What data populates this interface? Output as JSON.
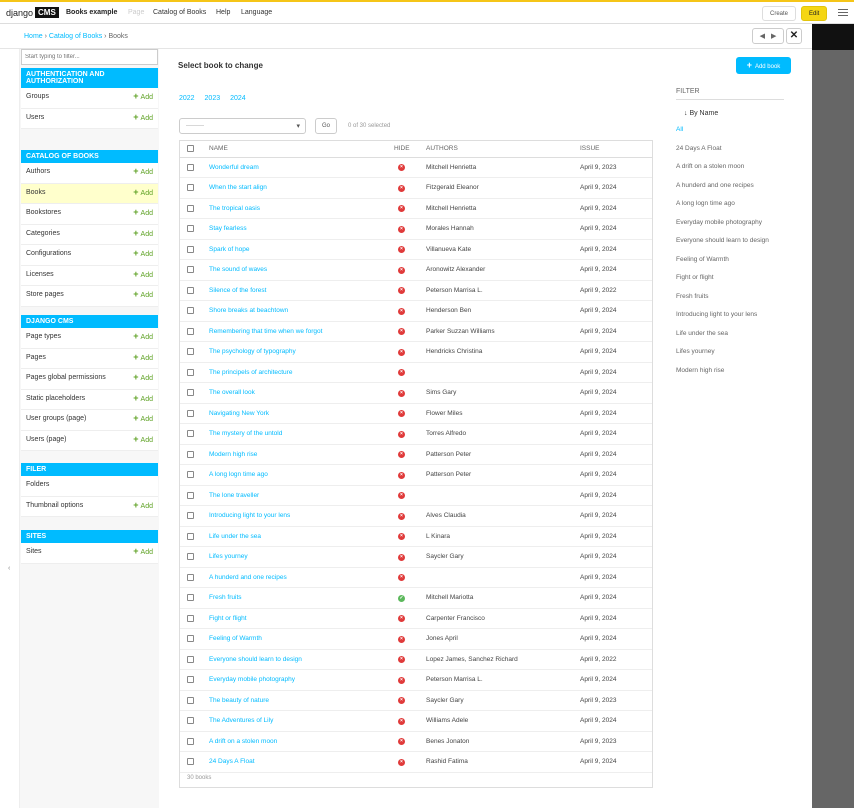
{
  "toolbar": {
    "logo_text": "django",
    "logo_box": "CMS",
    "site_name": "Books example",
    "page_label": "Page",
    "catalog_label": "Catalog of Books",
    "help_label": "Help",
    "language_label": "Language",
    "create_label": "Create",
    "edit_label": "Edit",
    "accent_color": "#00bbff",
    "edit_color": "#f5d613"
  },
  "breadcrumbs": {
    "home": "Home",
    "sep1": " › ",
    "catalog": "Catalog of Books",
    "sep2": " › ",
    "current": "Books"
  },
  "sidebar": {
    "filter_placeholder": "Start typing to filter...",
    "add_label": "Add",
    "modules": [
      {
        "title": "Authentication and Authorization",
        "items": [
          {
            "label": "Groups",
            "add": true
          },
          {
            "label": "Users",
            "add": true
          }
        ]
      },
      {
        "title": "Catalog of Books",
        "items": [
          {
            "label": "Authors",
            "add": true
          },
          {
            "label": "Books",
            "add": true,
            "active": true
          },
          {
            "label": "Bookstores",
            "add": true
          },
          {
            "label": "Categories",
            "add": true
          },
          {
            "label": "Configurations",
            "add": true
          },
          {
            "label": "Licenses",
            "add": true
          },
          {
            "label": "Store pages",
            "add": true
          }
        ]
      },
      {
        "title": "Django CMS",
        "items": [
          {
            "label": "Page types",
            "add": true
          },
          {
            "label": "Pages",
            "add": true
          },
          {
            "label": "Pages global permissions",
            "add": true
          },
          {
            "label": "Static placeholders",
            "add": true
          },
          {
            "label": "User groups (page)",
            "add": true
          },
          {
            "label": "Users (page)",
            "add": true
          }
        ]
      },
      {
        "title": "Filer",
        "items": [
          {
            "label": "Folders",
            "add": false
          },
          {
            "label": "Thumbnail options",
            "add": true
          }
        ]
      },
      {
        "title": "Sites",
        "items": [
          {
            "label": "Sites",
            "add": true
          }
        ]
      }
    ]
  },
  "content": {
    "title": "Select book to change",
    "add_button": "Add book",
    "years": [
      "2022",
      "2023",
      "2024"
    ],
    "action_placeholder": "---------",
    "go_label": "Go",
    "selected_text": "0 of 30 selected",
    "columns": [
      "Name",
      "Hide",
      "Authors",
      "Issue"
    ],
    "footer": "30 books",
    "rows": [
      {
        "name": "Wonderful dream",
        "hide": false,
        "authors": "Mitchell Henrietta",
        "issue": "April 9, 2023"
      },
      {
        "name": "When the start align",
        "hide": false,
        "authors": "Fitzgerald Eleanor",
        "issue": "April 9, 2024"
      },
      {
        "name": "The tropical oasis",
        "hide": false,
        "authors": "Mitchell Henrietta",
        "issue": "April 9, 2024"
      },
      {
        "name": "Stay fearless",
        "hide": false,
        "authors": "Morales Hannah",
        "issue": "April 9, 2024"
      },
      {
        "name": "Spark of hope",
        "hide": false,
        "authors": "Villanueva Kate",
        "issue": "April 9, 2024"
      },
      {
        "name": "The sound of waves",
        "hide": false,
        "authors": "Aronowitz Alexander",
        "issue": "April 9, 2024"
      },
      {
        "name": "Silence of the forest",
        "hide": false,
        "authors": "Peterson Marrisa L.",
        "issue": "April 9, 2022"
      },
      {
        "name": "Shore breaks at beachtown",
        "hide": false,
        "authors": "Henderson Ben",
        "issue": "April 9, 2024"
      },
      {
        "name": "Remembering that time when we forgot",
        "hide": false,
        "authors": "Parker Suzzan Williams",
        "issue": "April 9, 2024"
      },
      {
        "name": "The psychology of typography",
        "hide": false,
        "authors": "Hendricks Christina",
        "issue": "April 9, 2024"
      },
      {
        "name": "The principels of architecture",
        "hide": false,
        "authors": "",
        "issue": "April 9, 2024"
      },
      {
        "name": "The overall look",
        "hide": false,
        "authors": "Sims Gary",
        "issue": "April 9, 2024"
      },
      {
        "name": "Navigating New York",
        "hide": false,
        "authors": "Flower Miles",
        "issue": "April 9, 2024"
      },
      {
        "name": "The mystery of the untold",
        "hide": false,
        "authors": "Torres Alfredo",
        "issue": "April 9, 2024"
      },
      {
        "name": "Modern high rise",
        "hide": false,
        "authors": "Patterson Peter",
        "issue": "April 9, 2024"
      },
      {
        "name": "A long logn time ago",
        "hide": false,
        "authors": "Patterson Peter",
        "issue": "April 9, 2024"
      },
      {
        "name": "The lone traveller",
        "hide": false,
        "authors": "",
        "issue": "April 9, 2024"
      },
      {
        "name": "Introducing light to your lens",
        "hide": false,
        "authors": "Alves Claudia",
        "issue": "April 9, 2024"
      },
      {
        "name": "Life under the sea",
        "hide": false,
        "authors": "L Kinara",
        "issue": "April 9, 2024"
      },
      {
        "name": "Lifes yourney",
        "hide": false,
        "authors": "Saycler Gary",
        "issue": "April 9, 2024"
      },
      {
        "name": "A hunderd and one recipes",
        "hide": false,
        "authors": "",
        "issue": "April 9, 2024"
      },
      {
        "name": "Fresh fruits",
        "hide": true,
        "authors": "Mitchell Mariotta",
        "issue": "April 9, 2024"
      },
      {
        "name": "Fight or flight",
        "hide": false,
        "authors": "Carpenter Francisco",
        "issue": "April 9, 2024"
      },
      {
        "name": "Feeling of Warmth",
        "hide": false,
        "authors": "Jones April",
        "issue": "April 9, 2024"
      },
      {
        "name": "Everyone should learn to design",
        "hide": false,
        "authors": "Lopez James, Sanchez Richard",
        "issue": "April 9, 2022"
      },
      {
        "name": "Everyday mobile photography",
        "hide": false,
        "authors": "Peterson Marrisa L.",
        "issue": "April 9, 2024"
      },
      {
        "name": "The beauty of nature",
        "hide": false,
        "authors": "Saycler Gary",
        "issue": "April 9, 2023"
      },
      {
        "name": "The Adventures of Lily",
        "hide": false,
        "authors": "Williams Adele",
        "issue": "April 9, 2024"
      },
      {
        "name": "A drift on a stolen moon",
        "hide": false,
        "authors": "Benes Jonaton",
        "issue": "April 9, 2023"
      },
      {
        "name": "24 Days A Float",
        "hide": false,
        "authors": "Rashid Fatima",
        "issue": "April 9, 2024"
      }
    ]
  },
  "filter": {
    "title": "Filter",
    "sub": "↓ By Name",
    "items": [
      {
        "label": "All",
        "selected": true
      },
      {
        "label": "24 Days A Float"
      },
      {
        "label": "A drift on a stolen moon"
      },
      {
        "label": "A hunderd and one recipes"
      },
      {
        "label": "A long logn time ago"
      },
      {
        "label": "Everyday mobile photography"
      },
      {
        "label": "Everyone should learn to design"
      },
      {
        "label": "Feeling of Warmth"
      },
      {
        "label": "Fight or flight"
      },
      {
        "label": "Fresh fruits"
      },
      {
        "label": "Introducing light to your lens"
      },
      {
        "label": "Life under the sea"
      },
      {
        "label": "Lifes yourney"
      },
      {
        "label": "Modern high rise"
      }
    ]
  }
}
